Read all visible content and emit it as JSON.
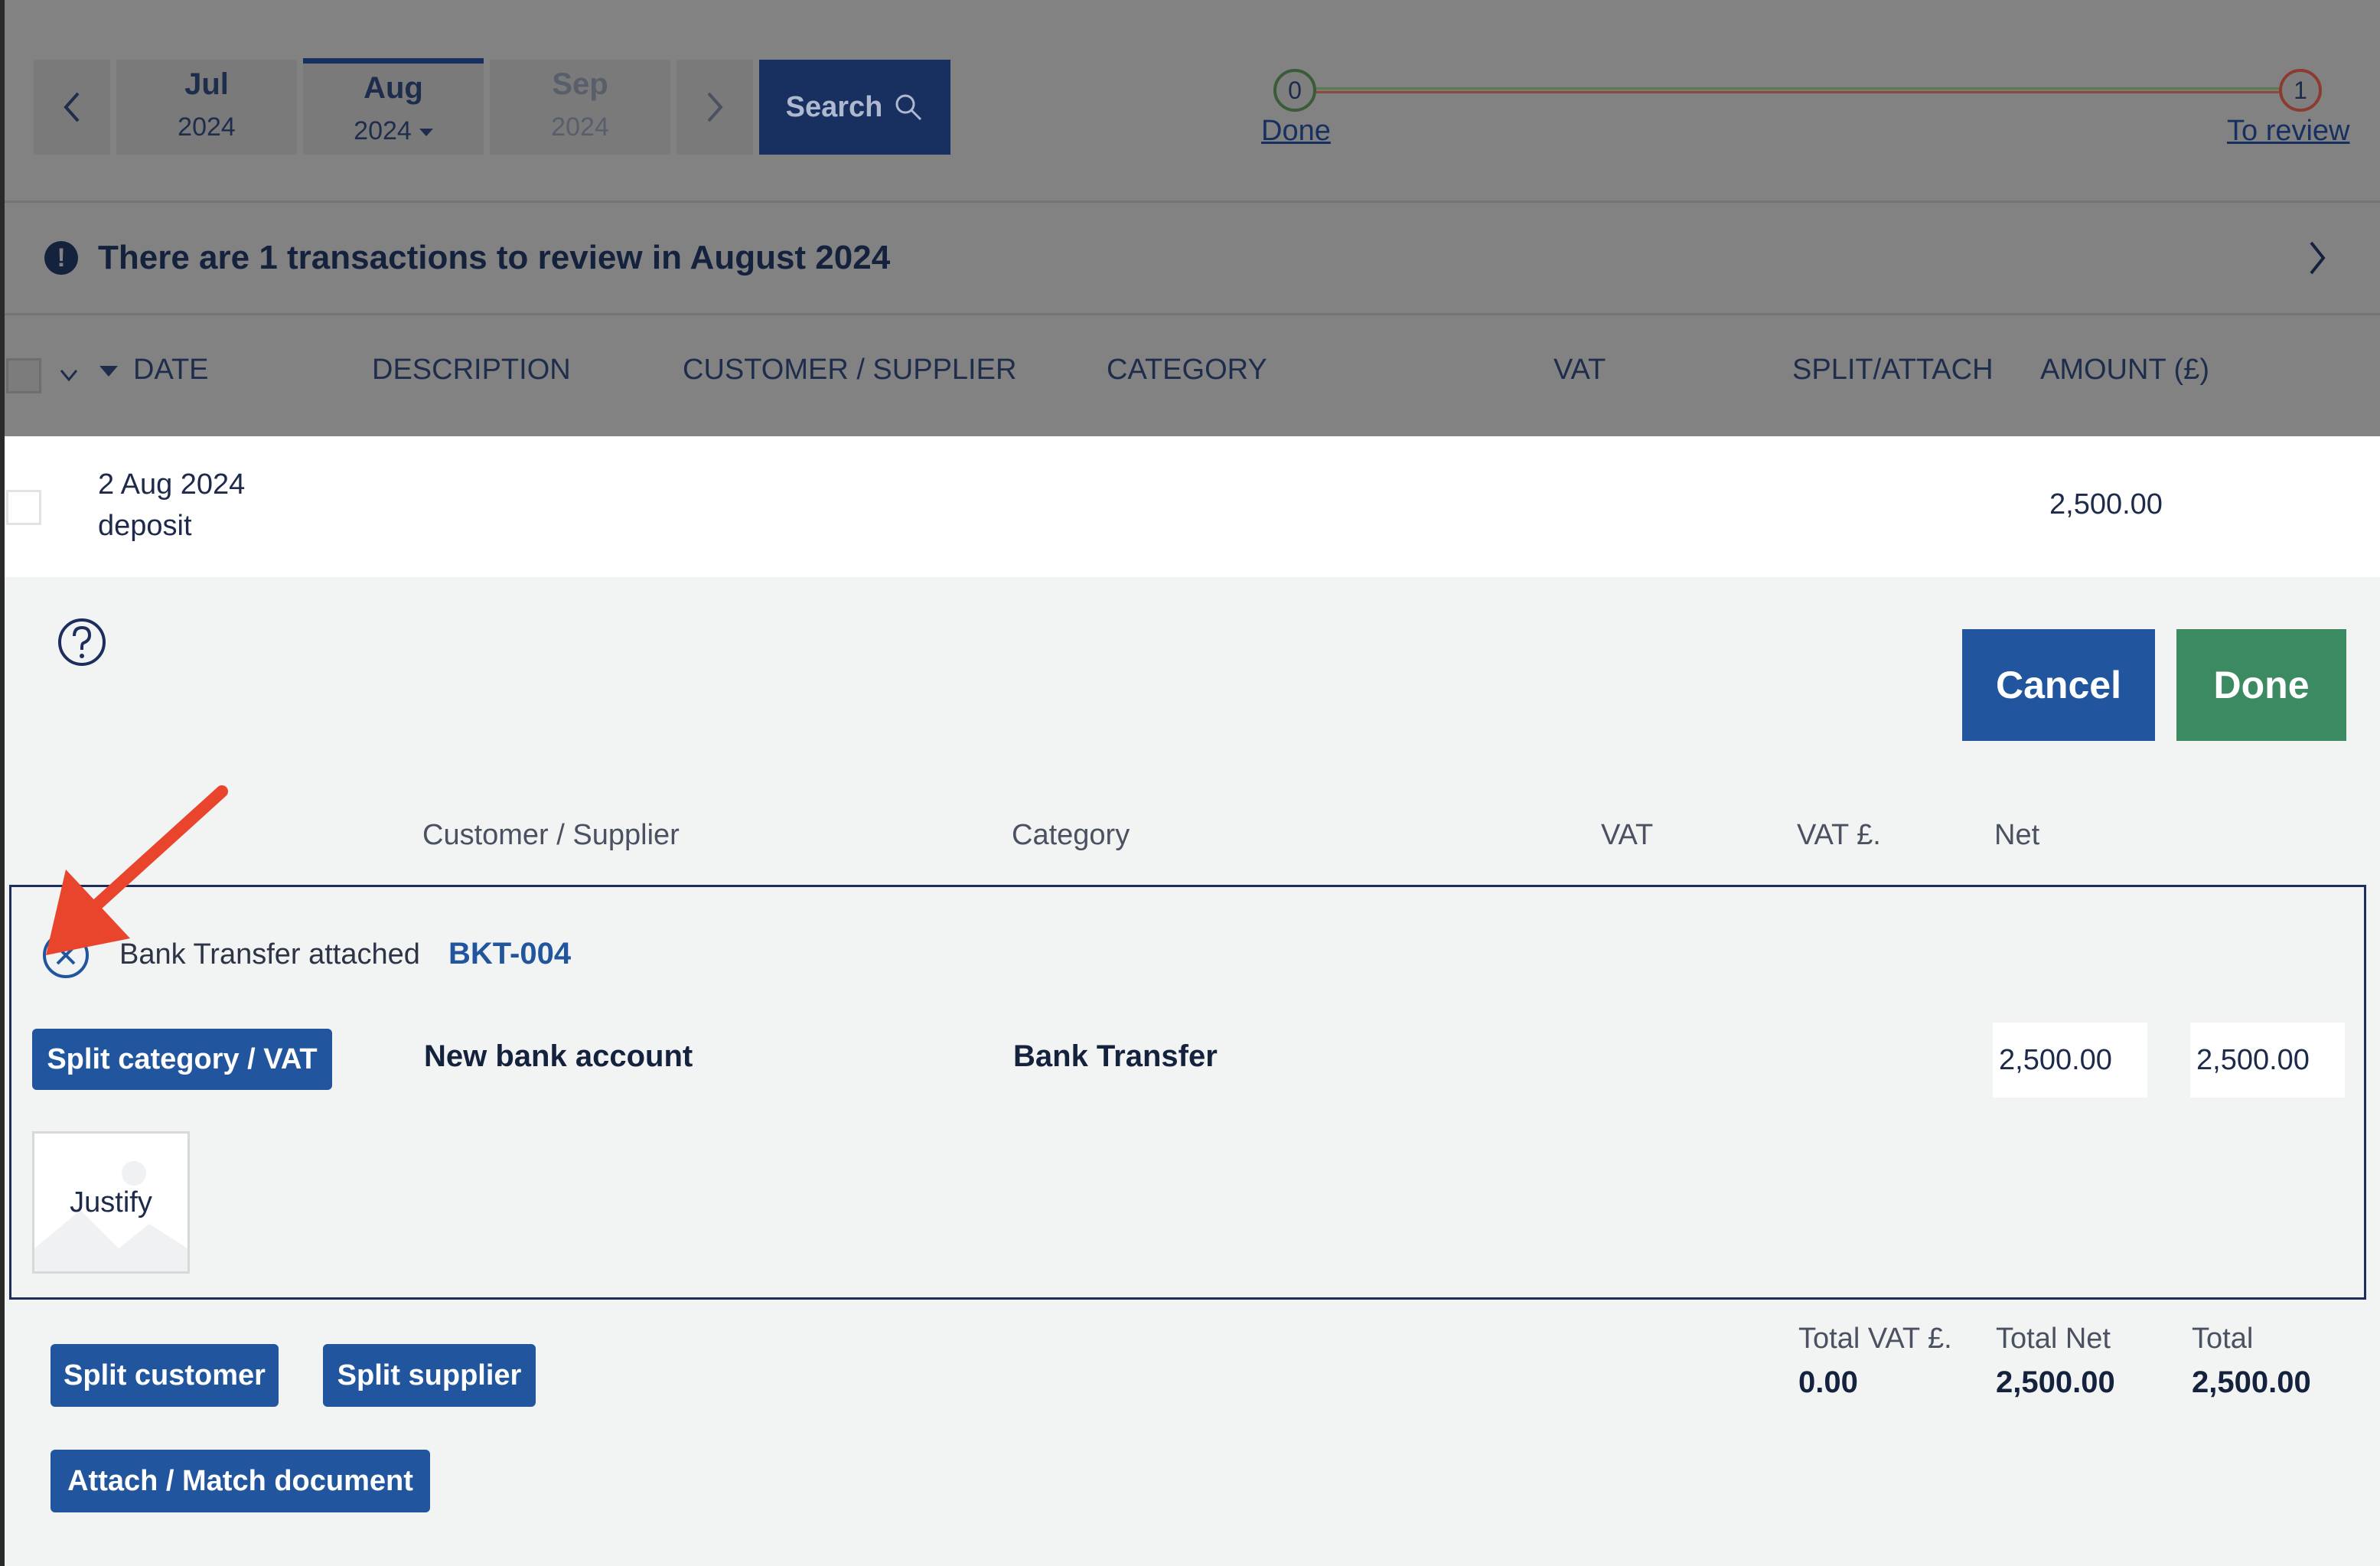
{
  "nav": {
    "months": [
      {
        "month": "Jul",
        "year": "2024"
      },
      {
        "month": "Aug",
        "year": "2024"
      },
      {
        "month": "Sep",
        "year": "2024"
      }
    ],
    "search_label": "Search"
  },
  "progress": {
    "done_count": "0",
    "done_label": "Done",
    "review_count": "1",
    "review_label": "To review"
  },
  "banner": {
    "text": "There are 1 transactions to review in August 2024"
  },
  "table": {
    "columns": [
      "DATE",
      "DESCRIPTION",
      "CUSTOMER / SUPPLIER",
      "CATEGORY",
      "VAT",
      "SPLIT/ATTACH",
      "AMOUNT (£)"
    ]
  },
  "transaction": {
    "date": "2 Aug 2024",
    "description": "deposit",
    "amount": "2,500.00"
  },
  "editor": {
    "cancel_label": "Cancel",
    "done_label": "Done",
    "headers": [
      "Customer / Supplier",
      "Category",
      "VAT",
      "VAT £.",
      "Net"
    ],
    "attached_text": "Bank Transfer attached",
    "attached_ref": "BKT-004",
    "split_category_label": "Split category / VAT",
    "customer_supplier": "New bank account",
    "category": "Bank Transfer",
    "vat_value": "2,500.00",
    "net_value": "2,500.00",
    "justify_label": "Justify",
    "split_customer_label": "Split customer",
    "split_supplier_label": "Split supplier",
    "attach_match_label": "Attach / Match document",
    "totals": {
      "vat_label": "Total VAT £.",
      "vat_value": "0.00",
      "net_label": "Total Net",
      "net_value": "2,500.00",
      "total_label": "Total",
      "total_value": "2,500.00"
    }
  },
  "colors": {
    "primary": "#21569f",
    "done_green": "#3c8a62",
    "navy": "#17305f",
    "arrow_red": "#e8452c"
  }
}
